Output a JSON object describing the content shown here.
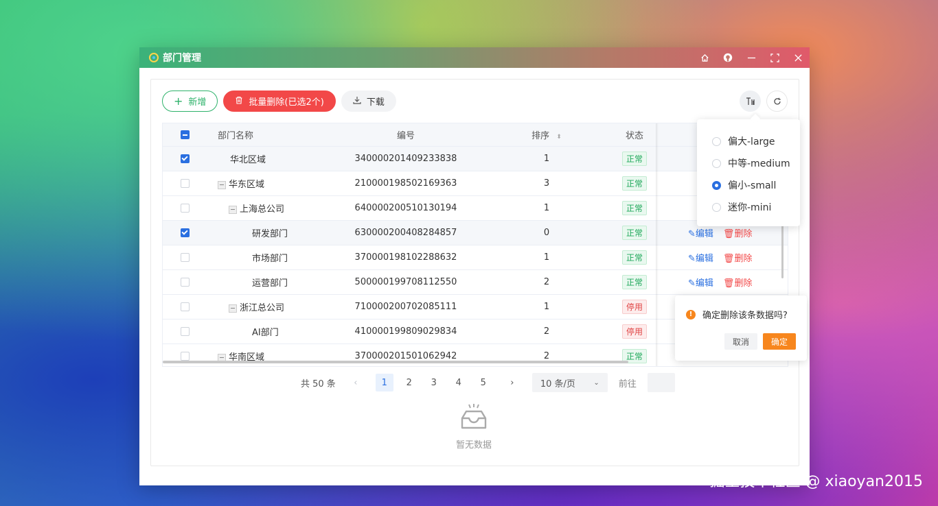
{
  "window": {
    "title": "部门管理",
    "controls": [
      "home-icon",
      "github-icon",
      "minimize-icon",
      "maximize-icon",
      "close-icon"
    ]
  },
  "toolbar": {
    "add_label": "新增",
    "batch_delete_label": "批量删除(已选2个)",
    "download_label": "下载"
  },
  "table": {
    "headers": {
      "name": "部门名称",
      "code": "编号",
      "sort": "排序",
      "status": "状态"
    },
    "rows": [
      {
        "checked": true,
        "indent": 0,
        "tree": false,
        "name": "华北区域",
        "code": "340000201409233838",
        "sort": "1",
        "status": "正常",
        "status_type": "ok"
      },
      {
        "checked": false,
        "indent": 0,
        "tree": true,
        "name": "华东区域",
        "code": "210000198502169363",
        "sort": "3",
        "status": "正常",
        "status_type": "ok"
      },
      {
        "checked": false,
        "indent": 1,
        "tree": true,
        "name": "上海总公司",
        "code": "640000200510130194",
        "sort": "1",
        "status": "正常",
        "status_type": "ok"
      },
      {
        "checked": true,
        "indent": 2,
        "tree": false,
        "name": "研发部门",
        "code": "630000200408284857",
        "sort": "0",
        "status": "正常",
        "status_type": "ok",
        "edit": "编辑",
        "delete": "删除"
      },
      {
        "checked": false,
        "indent": 2,
        "tree": false,
        "name": "市场部门",
        "code": "370000198102288632",
        "sort": "1",
        "status": "正常",
        "status_type": "ok",
        "edit": "编辑",
        "delete": "删除"
      },
      {
        "checked": false,
        "indent": 2,
        "tree": false,
        "name": "运营部门",
        "code": "500000199708112550",
        "sort": "2",
        "status": "正常",
        "status_type": "ok",
        "edit": "编辑",
        "delete": "删除"
      },
      {
        "checked": false,
        "indent": 1,
        "tree": true,
        "name": "浙江总公司",
        "code": "710000200702085111",
        "sort": "1",
        "status": "停用",
        "status_type": "stop"
      },
      {
        "checked": false,
        "indent": 2,
        "tree": false,
        "name": "AI部门",
        "code": "410000199809029834",
        "sort": "2",
        "status": "停用",
        "status_type": "stop"
      },
      {
        "checked": false,
        "indent": 0,
        "tree": true,
        "name": "华南区域",
        "code": "370000201501062942",
        "sort": "2",
        "status": "正常",
        "status_type": "ok"
      }
    ]
  },
  "pagination": {
    "total": "共 50 条",
    "pages": [
      "1",
      "2",
      "3",
      "4",
      "5"
    ],
    "current": "1",
    "page_size": "10 条/页",
    "goto": "前往"
  },
  "empty": {
    "text": "暂无数据"
  },
  "size_menu": {
    "options": [
      {
        "label": "偏大-large",
        "selected": false
      },
      {
        "label": "中等-medium",
        "selected": false
      },
      {
        "label": "偏小-small",
        "selected": true
      },
      {
        "label": "迷你-mini",
        "selected": false
      }
    ]
  },
  "confirm": {
    "message": "确定删除该条数据吗?",
    "cancel": "取消",
    "ok": "确定"
  },
  "watermark": "掘金技术社区 @ xiaoyan2015",
  "colors": {
    "primary": "#2a6fe0",
    "success": "#2db26a",
    "danger": "#f24848",
    "warning": "#f7861d"
  }
}
